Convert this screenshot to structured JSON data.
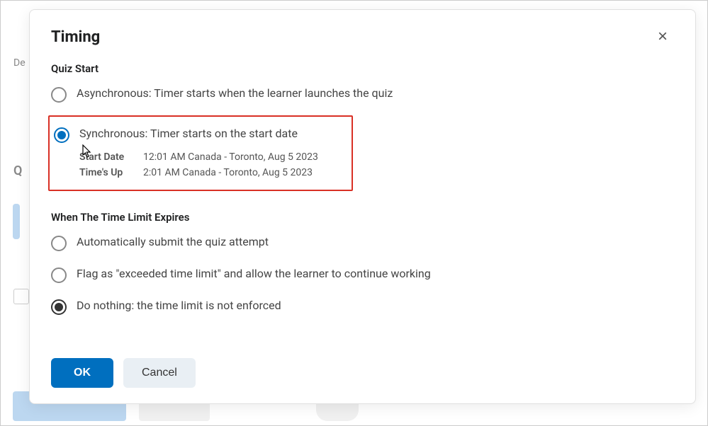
{
  "background": {
    "label_prefix": "De"
  },
  "modal": {
    "title": "Timing",
    "close_label": "×"
  },
  "quiz_start": {
    "section_label": "Quiz Start",
    "async_label": "Asynchronous: Timer starts when the learner launches the quiz",
    "sync_label": "Synchronous: Timer starts on the start date",
    "details": {
      "start_date_label": "Start Date",
      "start_date_value": "12:01 AM Canada - Toronto, Aug 5 2023",
      "times_up_label": "Time's Up",
      "times_up_value": "2:01 AM Canada - Toronto, Aug 5 2023"
    },
    "selected": "synchronous"
  },
  "time_limit": {
    "section_label": "When The Time Limit Expires",
    "auto_submit_label": "Automatically submit the quiz attempt",
    "flag_label": "Flag as \"exceeded time limit\" and allow the learner to continue working",
    "do_nothing_label": "Do nothing: the time limit is not enforced",
    "selected": "do_nothing"
  },
  "footer": {
    "ok_label": "OK",
    "cancel_label": "Cancel"
  }
}
